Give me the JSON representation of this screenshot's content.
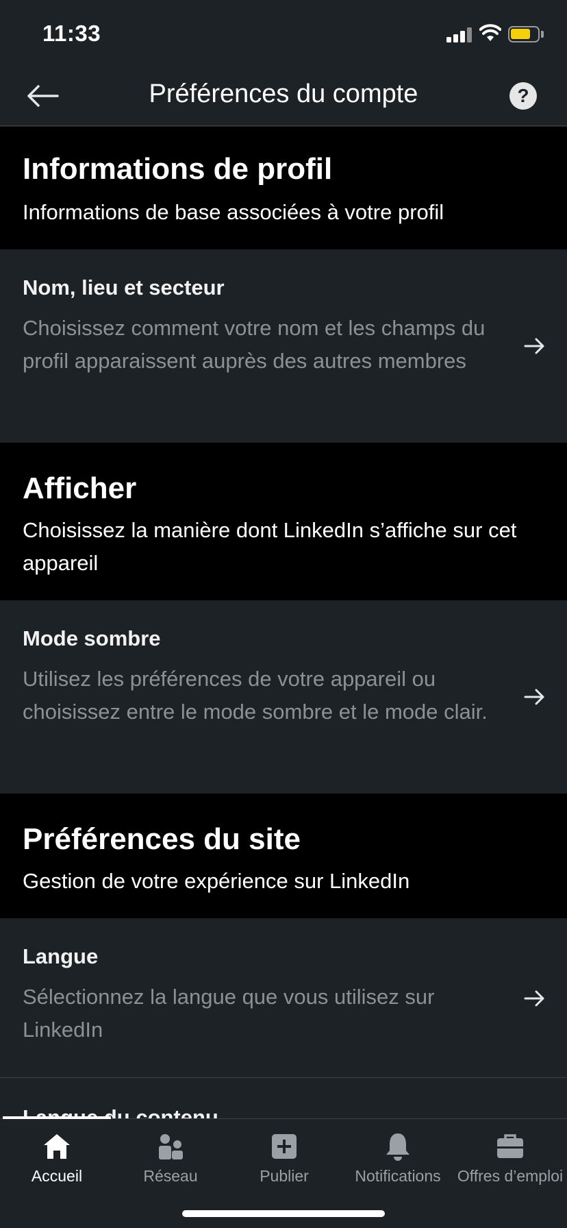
{
  "status_bar": {
    "time": "11:33"
  },
  "header": {
    "title": "Préférences du compte",
    "help_label": "?"
  },
  "sections": [
    {
      "title": "Informations de profil",
      "subtitle": "Informations de base associées à votre profil",
      "items": [
        {
          "title": "Nom, lieu et secteur",
          "description": "Choisissez comment votre nom et les champs du profil apparaissent auprès des autres membres"
        }
      ]
    },
    {
      "title": "Afficher",
      "subtitle": "Choisissez la manière dont LinkedIn s’affiche sur cet appareil",
      "items": [
        {
          "title": "Mode sombre",
          "description": "Utilisez les préférences de votre appareil ou choisissez entre le mode sombre et le mode clair."
        }
      ]
    },
    {
      "title": "Préférences du site",
      "subtitle": "Gestion de votre expérience sur LinkedIn",
      "items": [
        {
          "title": "Langue",
          "description": "Sélectionnez la langue que vous utilisez sur LinkedIn"
        },
        {
          "title": "Langue du contenu"
        }
      ]
    }
  ],
  "tab_bar": {
    "active": "Accueil",
    "tabs": [
      {
        "label": "Accueil",
        "icon": "home-icon"
      },
      {
        "label": "Réseau",
        "icon": "network-icon"
      },
      {
        "label": "Publier",
        "icon": "post-icon"
      },
      {
        "label": "Notifications",
        "icon": "bell-icon"
      },
      {
        "label": "Offres d’emploi",
        "icon": "briefcase-icon"
      }
    ]
  },
  "colors": {
    "background": "#1d2226",
    "section_header_bg": "#000000",
    "secondary_text": "#8d9196",
    "battery": "#f5d10a"
  }
}
